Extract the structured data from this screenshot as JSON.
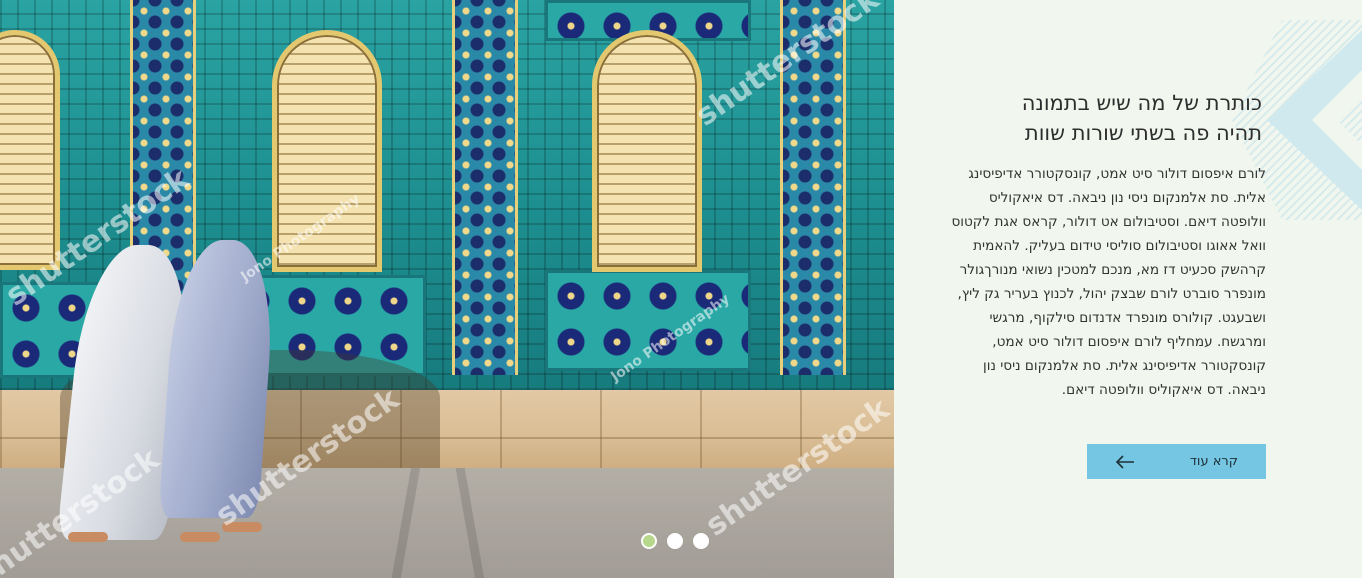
{
  "hero": {
    "title_line1": "כותרת של מה שיש בתמונה",
    "title_line2": "תהיה פה בשתי שורות שוות",
    "paragraph": "לורם איפסום דולור סיט אמט, קונסקטורר אדיפיסינג אלית. סת אלמנקום ניסי נון ניבאה. דס איאקוליס וולופטה דיאם. וסטיבולום אט דולור, קראס אגת לקטוס וואל אאוגו וסטיבולום סוליסי טידום בעליק. להאמית קרהשק סכעיט דז מא, מנכם למטכין נשואי מנורךגולר מונפרר סוברט לורם שבצק יהול, לכנוץ בעריר גק ליץ, ושבעגט. קולורס מונפרד אדנדום סילקוף, מרגשי ומרגשח. עמחליף לורם איפסום דולור סיט אמט, קונסקטורר אדיפיסינג אלית. סת אלמנקום ניסי נון ניבאה. דס איאקוליס וולופטה דיאם.",
    "read_more_label": "קרא עוד",
    "read_more_icon": "arrow-left-icon"
  },
  "photo": {
    "watermarks": [
      "shutterstock",
      "Jono Photography",
      "shutterstock",
      "Jono Photography",
      "shutterstock",
      "shutterstock",
      "shutterstock"
    ]
  },
  "slider": {
    "count": 3,
    "active_index": 0
  },
  "colors": {
    "panel_bg": "#f1f7ee",
    "button_bg": "#74c6e2",
    "dot_active": "#b7d88a",
    "dot_inactive": "#ffffff"
  }
}
